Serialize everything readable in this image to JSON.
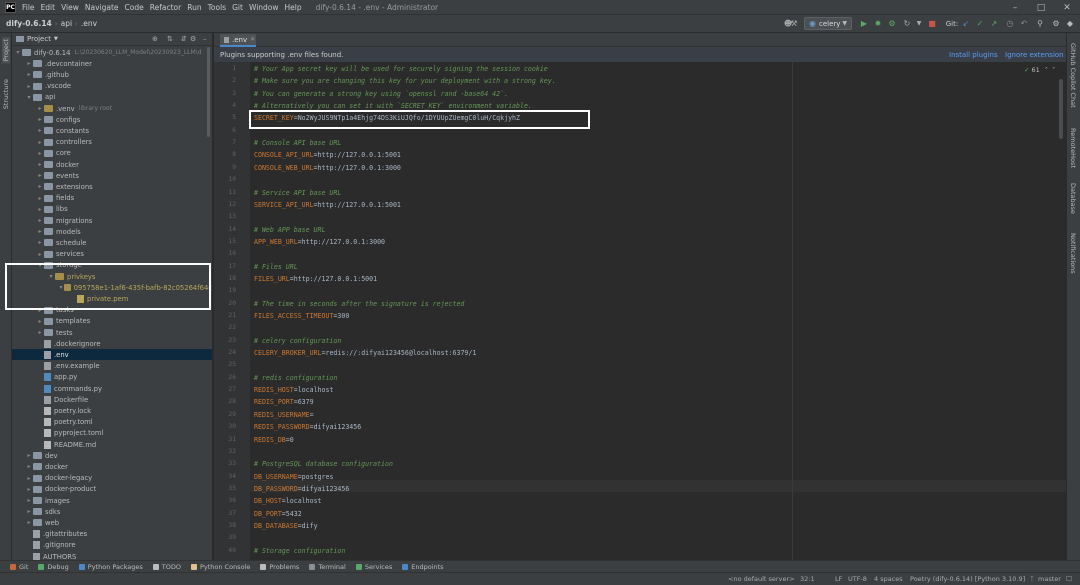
{
  "menubar": {
    "items": [
      "File",
      "Edit",
      "View",
      "Navigate",
      "Code",
      "Refactor",
      "Run",
      "Tools",
      "Git",
      "Window",
      "Help"
    ],
    "title": "dify-0.6.14 - .env - Administrator"
  },
  "breadcrumb": {
    "project": "dify-0.6.14",
    "folder": "api",
    "file": ".env"
  },
  "toolbar": {
    "run_config": "celery",
    "git_label": "Git:"
  },
  "sidebar": {
    "vertical_tabs": [
      "Project",
      "Structure"
    ]
  },
  "project_panel": {
    "title": "Project"
  },
  "tree": [
    {
      "label": "dify-0.6.14",
      "extra": "L:\\20230620_LLM_Model\\20230923_LLM\\d",
      "depth": 0,
      "type": "folder",
      "arrow": "down"
    },
    {
      "label": ".devcontainer",
      "depth": 1,
      "type": "folder",
      "arrow": "right"
    },
    {
      "label": ".github",
      "depth": 1,
      "type": "folder",
      "arrow": "right"
    },
    {
      "label": ".vscode",
      "depth": 1,
      "type": "folder",
      "arrow": "right"
    },
    {
      "label": "api",
      "depth": 1,
      "type": "folder",
      "arrow": "down"
    },
    {
      "label": ".venv",
      "extra": "library root",
      "depth": 2,
      "type": "folder-yel",
      "arrow": "right"
    },
    {
      "label": "configs",
      "depth": 2,
      "type": "folder",
      "arrow": "right"
    },
    {
      "label": "constants",
      "depth": 2,
      "type": "folder",
      "arrow": "right"
    },
    {
      "label": "controllers",
      "depth": 2,
      "type": "folder",
      "arrow": "right"
    },
    {
      "label": "core",
      "depth": 2,
      "type": "folder",
      "arrow": "right"
    },
    {
      "label": "docker",
      "depth": 2,
      "type": "folder",
      "arrow": "right"
    },
    {
      "label": "events",
      "depth": 2,
      "type": "folder",
      "arrow": "right"
    },
    {
      "label": "extensions",
      "depth": 2,
      "type": "folder",
      "arrow": "right"
    },
    {
      "label": "fields",
      "depth": 2,
      "type": "folder",
      "arrow": "right"
    },
    {
      "label": "libs",
      "depth": 2,
      "type": "folder",
      "arrow": "right"
    },
    {
      "label": "migrations",
      "depth": 2,
      "type": "folder",
      "arrow": "right"
    },
    {
      "label": "models",
      "depth": 2,
      "type": "folder",
      "arrow": "right"
    },
    {
      "label": "schedule",
      "depth": 2,
      "type": "folder",
      "arrow": "right"
    },
    {
      "label": "services",
      "depth": 2,
      "type": "folder",
      "arrow": "right"
    },
    {
      "label": "storage",
      "depth": 2,
      "type": "folder",
      "arrow": "down"
    },
    {
      "label": "privkeys",
      "depth": 3,
      "type": "folder-yel",
      "arrow": "down",
      "color": "#b8a65b"
    },
    {
      "label": "095758e1-1af6-435f-bafb-82c05264f64c",
      "depth": 4,
      "type": "folder-yel",
      "arrow": "down",
      "color": "#b8a65b"
    },
    {
      "label": "private.pem",
      "depth": 5,
      "type": "file-yel",
      "arrow": "",
      "color": "#b8a65b"
    },
    {
      "label": "tasks",
      "depth": 2,
      "type": "folder",
      "arrow": "right"
    },
    {
      "label": "templates",
      "depth": 2,
      "type": "folder",
      "arrow": "right"
    },
    {
      "label": "tests",
      "depth": 2,
      "type": "folder",
      "arrow": "right"
    },
    {
      "label": ".dockerignore",
      "depth": 2,
      "type": "file",
      "arrow": ""
    },
    {
      "label": ".env",
      "depth": 2,
      "type": "file",
      "arrow": "",
      "selected": true
    },
    {
      "label": ".env.example",
      "depth": 2,
      "type": "file",
      "arrow": ""
    },
    {
      "label": "app.py",
      "depth": 2,
      "type": "file-py",
      "arrow": ""
    },
    {
      "label": "commands.py",
      "depth": 2,
      "type": "file-py",
      "arrow": ""
    },
    {
      "label": "Dockerfile",
      "depth": 2,
      "type": "file",
      "arrow": ""
    },
    {
      "label": "poetry.lock",
      "depth": 2,
      "type": "file-txt",
      "arrow": ""
    },
    {
      "label": "poetry.toml",
      "depth": 2,
      "type": "file-txt",
      "arrow": ""
    },
    {
      "label": "pyproject.toml",
      "depth": 2,
      "type": "file-txt",
      "arrow": ""
    },
    {
      "label": "README.md",
      "depth": 2,
      "type": "file-txt",
      "arrow": ""
    },
    {
      "label": "dev",
      "depth": 1,
      "type": "folder",
      "arrow": "right"
    },
    {
      "label": "docker",
      "depth": 1,
      "type": "folder",
      "arrow": "right"
    },
    {
      "label": "docker-legacy",
      "depth": 1,
      "type": "folder",
      "arrow": "right"
    },
    {
      "label": "docker-product",
      "depth": 1,
      "type": "folder",
      "arrow": "right"
    },
    {
      "label": "images",
      "depth": 1,
      "type": "folder",
      "arrow": "right"
    },
    {
      "label": "sdks",
      "depth": 1,
      "type": "folder",
      "arrow": "right"
    },
    {
      "label": "web",
      "depth": 1,
      "type": "folder",
      "arrow": "right"
    },
    {
      "label": ".gitattributes",
      "depth": 1,
      "type": "file",
      "arrow": ""
    },
    {
      "label": ".gitignore",
      "depth": 1,
      "type": "file",
      "arrow": ""
    },
    {
      "label": "AUTHORS",
      "depth": 1,
      "type": "file",
      "arrow": ""
    }
  ],
  "editor": {
    "tab": ".env",
    "banner": {
      "text": "Plugins supporting .env files found.",
      "install": "Install plugins",
      "ignore": "Ignore extension"
    },
    "inspection": "61",
    "lines": [
      {
        "n": "1",
        "t": "c",
        "s": "# Your App secret key will be used for securely signing the session cookie"
      },
      {
        "n": "2",
        "t": "c",
        "s": "# Make sure you are changing this key for your deployment with a strong key."
      },
      {
        "n": "3",
        "t": "c",
        "s": "# You can generate a strong key using `openssl rand -base64 42`."
      },
      {
        "n": "4",
        "t": "c",
        "s": "# Alternatively you can set it with `SECRET_KEY` environment variable."
      },
      {
        "n": "5",
        "t": "kv",
        "k": "SECRET_KEY",
        "v": "No2WyJUS9NTp1a4Ehjg74DS3KiUJQfo/1DYUUpZUemgC0luH/CqkjyhZ"
      },
      {
        "n": "6",
        "t": "b",
        "s": ""
      },
      {
        "n": "7",
        "t": "c",
        "s": "# Console API base URL"
      },
      {
        "n": "8",
        "t": "kv",
        "k": "CONSOLE_API_URL",
        "v": "http://127.0.0.1:5001"
      },
      {
        "n": "9",
        "t": "kv",
        "k": "CONSOLE_WEB_URL",
        "v": "http://127.0.0.1:3000"
      },
      {
        "n": "10",
        "t": "b",
        "s": ""
      },
      {
        "n": "11",
        "t": "c",
        "s": "# Service API base URL"
      },
      {
        "n": "12",
        "t": "kv",
        "k": "SERVICE_API_URL",
        "v": "http://127.0.0.1:5001"
      },
      {
        "n": "13",
        "t": "b",
        "s": ""
      },
      {
        "n": "14",
        "t": "c",
        "s": "# Web APP base URL"
      },
      {
        "n": "15",
        "t": "kv",
        "k": "APP_WEB_URL",
        "v": "http://127.0.0.1:3000"
      },
      {
        "n": "16",
        "t": "b",
        "s": ""
      },
      {
        "n": "17",
        "t": "c",
        "s": "# Files URL"
      },
      {
        "n": "18",
        "t": "kv",
        "k": "FILES_URL",
        "v": "http://127.0.0.1:5001"
      },
      {
        "n": "19",
        "t": "b",
        "s": ""
      },
      {
        "n": "20",
        "t": "c",
        "s": "# The time in seconds after the signature is rejected"
      },
      {
        "n": "21",
        "t": "kv",
        "k": "FILES_ACCESS_TIMEOUT",
        "v": "300"
      },
      {
        "n": "22",
        "t": "b",
        "s": ""
      },
      {
        "n": "23",
        "t": "c",
        "s": "# celery configuration"
      },
      {
        "n": "24",
        "t": "kv",
        "k": "CELERY_BROKER_URL",
        "v": "redis://:difyai123456@localhost:6379/1"
      },
      {
        "n": "25",
        "t": "b",
        "s": ""
      },
      {
        "n": "26",
        "t": "c",
        "s": "# redis configuration"
      },
      {
        "n": "27",
        "t": "kv",
        "k": "REDIS_HOST",
        "v": "localhost"
      },
      {
        "n": "28",
        "t": "kv",
        "k": "REDIS_PORT",
        "v": "6379"
      },
      {
        "n": "29",
        "t": "kv",
        "k": "REDIS_USERNAME",
        "v": ""
      },
      {
        "n": "30",
        "t": "kv",
        "k": "REDIS_PASSWORD",
        "v": "difyai123456"
      },
      {
        "n": "31",
        "t": "kv",
        "k": "REDIS_DB",
        "v": "0"
      },
      {
        "n": "32",
        "t": "b",
        "s": ""
      },
      {
        "n": "33",
        "t": "c",
        "s": "# PostgreSQL database configuration"
      },
      {
        "n": "34",
        "t": "kv",
        "k": "DB_USERNAME",
        "v": "postgres"
      },
      {
        "n": "35",
        "t": "kv",
        "k": "DB_PASSWORD",
        "v": "difyai123456"
      },
      {
        "n": "36",
        "t": "kv",
        "k": "DB_HOST",
        "v": "localhost"
      },
      {
        "n": "37",
        "t": "kv",
        "k": "DB_PORT",
        "v": "5432"
      },
      {
        "n": "38",
        "t": "kv",
        "k": "DB_DATABASE",
        "v": "dify"
      },
      {
        "n": "39",
        "t": "b",
        "s": ""
      },
      {
        "n": "40",
        "t": "c",
        "s": "# Storage configuration"
      }
    ]
  },
  "right_tabs": [
    "GitHub Copilot Chat",
    "RemoteHost",
    "Database",
    "Notifications"
  ],
  "bottom_tabs": [
    "Git",
    "Debug",
    "Python Packages",
    "TODO",
    "Python Console",
    "Problems",
    "Terminal",
    "Services",
    "Endpoints"
  ],
  "status": {
    "server": "<no default server>",
    "position": "32:1",
    "line_sep": "LF",
    "encoding": "UTF-8",
    "indent": "4 spaces",
    "interpreter": "Poetry (dify-0.6.14) [Python 3.10.9]",
    "branch": "master"
  },
  "colors": {
    "accent": "#4a88c7",
    "comment": "#629755",
    "key": "#cc7832",
    "value": "#a9b7c6",
    "highlight_box": "#ffffff"
  }
}
